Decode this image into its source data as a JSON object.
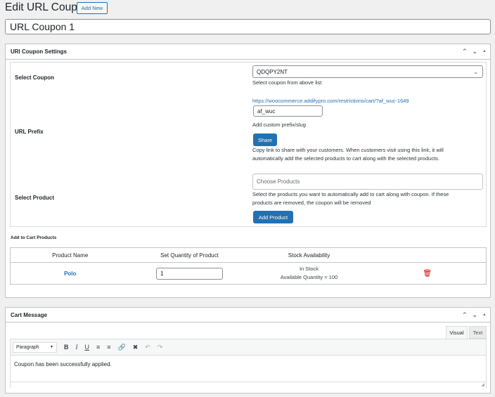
{
  "page": {
    "title": "Edit URL Coupon",
    "add_new": "Add New",
    "coupon_title": "URL Coupon 1"
  },
  "settings": {
    "heading": "URl Coupon Settings",
    "select_coupon_label": "Select Coupon",
    "selected_coupon": "QDQPY2NT",
    "select_coupon_help": "Select coupon from above list",
    "url_prefix_label": "URL Prefix",
    "url": "https://woocommerce.addifypro.com/restrictions/cart/?af_wuc-1649",
    "prefix_value": "af_wuc",
    "prefix_help": "Add custom prefix/slug",
    "share_label": "Share",
    "share_help_1": "Copy link to share with your customers. When customers visit using this link, it will",
    "share_help_2": "automatically add the selected products to cart along with the selected products.",
    "select_product_label": "Select Product",
    "choose_placeholder": "Choose Products",
    "product_help_1": "Select the products you want to automatically add to cart along with coupon. If these",
    "product_help_2": "products are removed, the coupon will be removed",
    "add_product_label": "Add Product",
    "cart_products_heading": "Add to Cart Products",
    "columns": [
      "Product Name",
      "Set Quantity of Product",
      "Stock Availability"
    ],
    "rows": [
      {
        "name": "Polo",
        "quantity": "1",
        "stock": "In Stock",
        "available": "Available Quantity = 100"
      }
    ]
  },
  "cart_message": {
    "heading": "Cart Message",
    "tab_visual": "Visual",
    "tab_text": "Text",
    "format": "Paragraph",
    "content": "Coupon has been successfully applied."
  },
  "colors": {
    "accent": "#2271b1",
    "delete": "#e00000"
  }
}
